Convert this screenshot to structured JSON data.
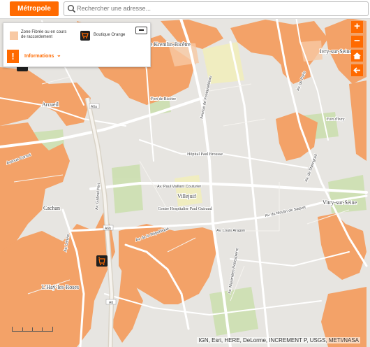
{
  "colors": {
    "accent": "#ff6a00",
    "fiber_zone": "#f3a268",
    "fiber_zone_light": "#f8c9a4",
    "shop_icon": "#1f1f1f",
    "map_background": "#e7e5e1",
    "road": "#ffffff",
    "park": "#ccdfb0",
    "highlight_zone": "#f0edc0"
  },
  "toolbar": {
    "metropole_label": "Métropole",
    "search_placeholder": "Rechercher une adresse..."
  },
  "legend": {
    "fiber_label": "Zone Fibrée ou en cours de raccordement",
    "shop_label": "Boutique Orange",
    "info_label": "Informations",
    "info_icon_glyph": "!",
    "chevron_glyph": "⌄"
  },
  "controls": {
    "zoom_in_label": "+",
    "zoom_out_label": "−",
    "home_icon": "home-icon",
    "back_icon": "arrow-left-icon"
  },
  "map": {
    "places": [
      {
        "name": "Le Kremlin-Bicêtre",
        "class": "town"
      },
      {
        "name": "Ivry-sur-Seine",
        "class": "town"
      },
      {
        "name": "Arcueil",
        "class": "town"
      },
      {
        "name": "Villejuif",
        "class": "town"
      },
      {
        "name": "Cachan",
        "class": "town"
      },
      {
        "name": "L'Haÿ-les-Roses",
        "class": "town"
      },
      {
        "name": "Vitry-sur-Seine",
        "class": "town"
      },
      {
        "name": "Hôpital Paul Brousse",
        "class": "poi"
      },
      {
        "name": "Centre Hospitalier Paul Guiraud",
        "class": "poi"
      },
      {
        "name": "Fort de Bicêtre",
        "class": "poi"
      },
      {
        "name": "Fort d'Ivry",
        "class": "poi"
      }
    ],
    "roads": [
      {
        "name": "Av. Paul Vaillant Couturier"
      },
      {
        "name": "Av. de la République"
      },
      {
        "name": "Av. Louis Aragon"
      },
      {
        "name": "Av. du Moulin de Saquet"
      },
      {
        "name": "Av. Maximilien Robespierre"
      },
      {
        "name": "Av. de Stalingrad"
      },
      {
        "name": "Av. Gabriel Péri"
      },
      {
        "name": "Av. Lénine"
      },
      {
        "name": "Avenue Carnot"
      },
      {
        "name": "Avenue de Fontainebleau"
      },
      {
        "name": "Av. de Paris"
      }
    ],
    "highways": [
      "A6a",
      "A6b",
      "A6"
    ],
    "shops": [
      {
        "name": "Boutique Orange"
      }
    ],
    "attribution": "IGN, Esri, HERE, DeLorme, INCREMENT P, USGS, METI/NASA"
  }
}
